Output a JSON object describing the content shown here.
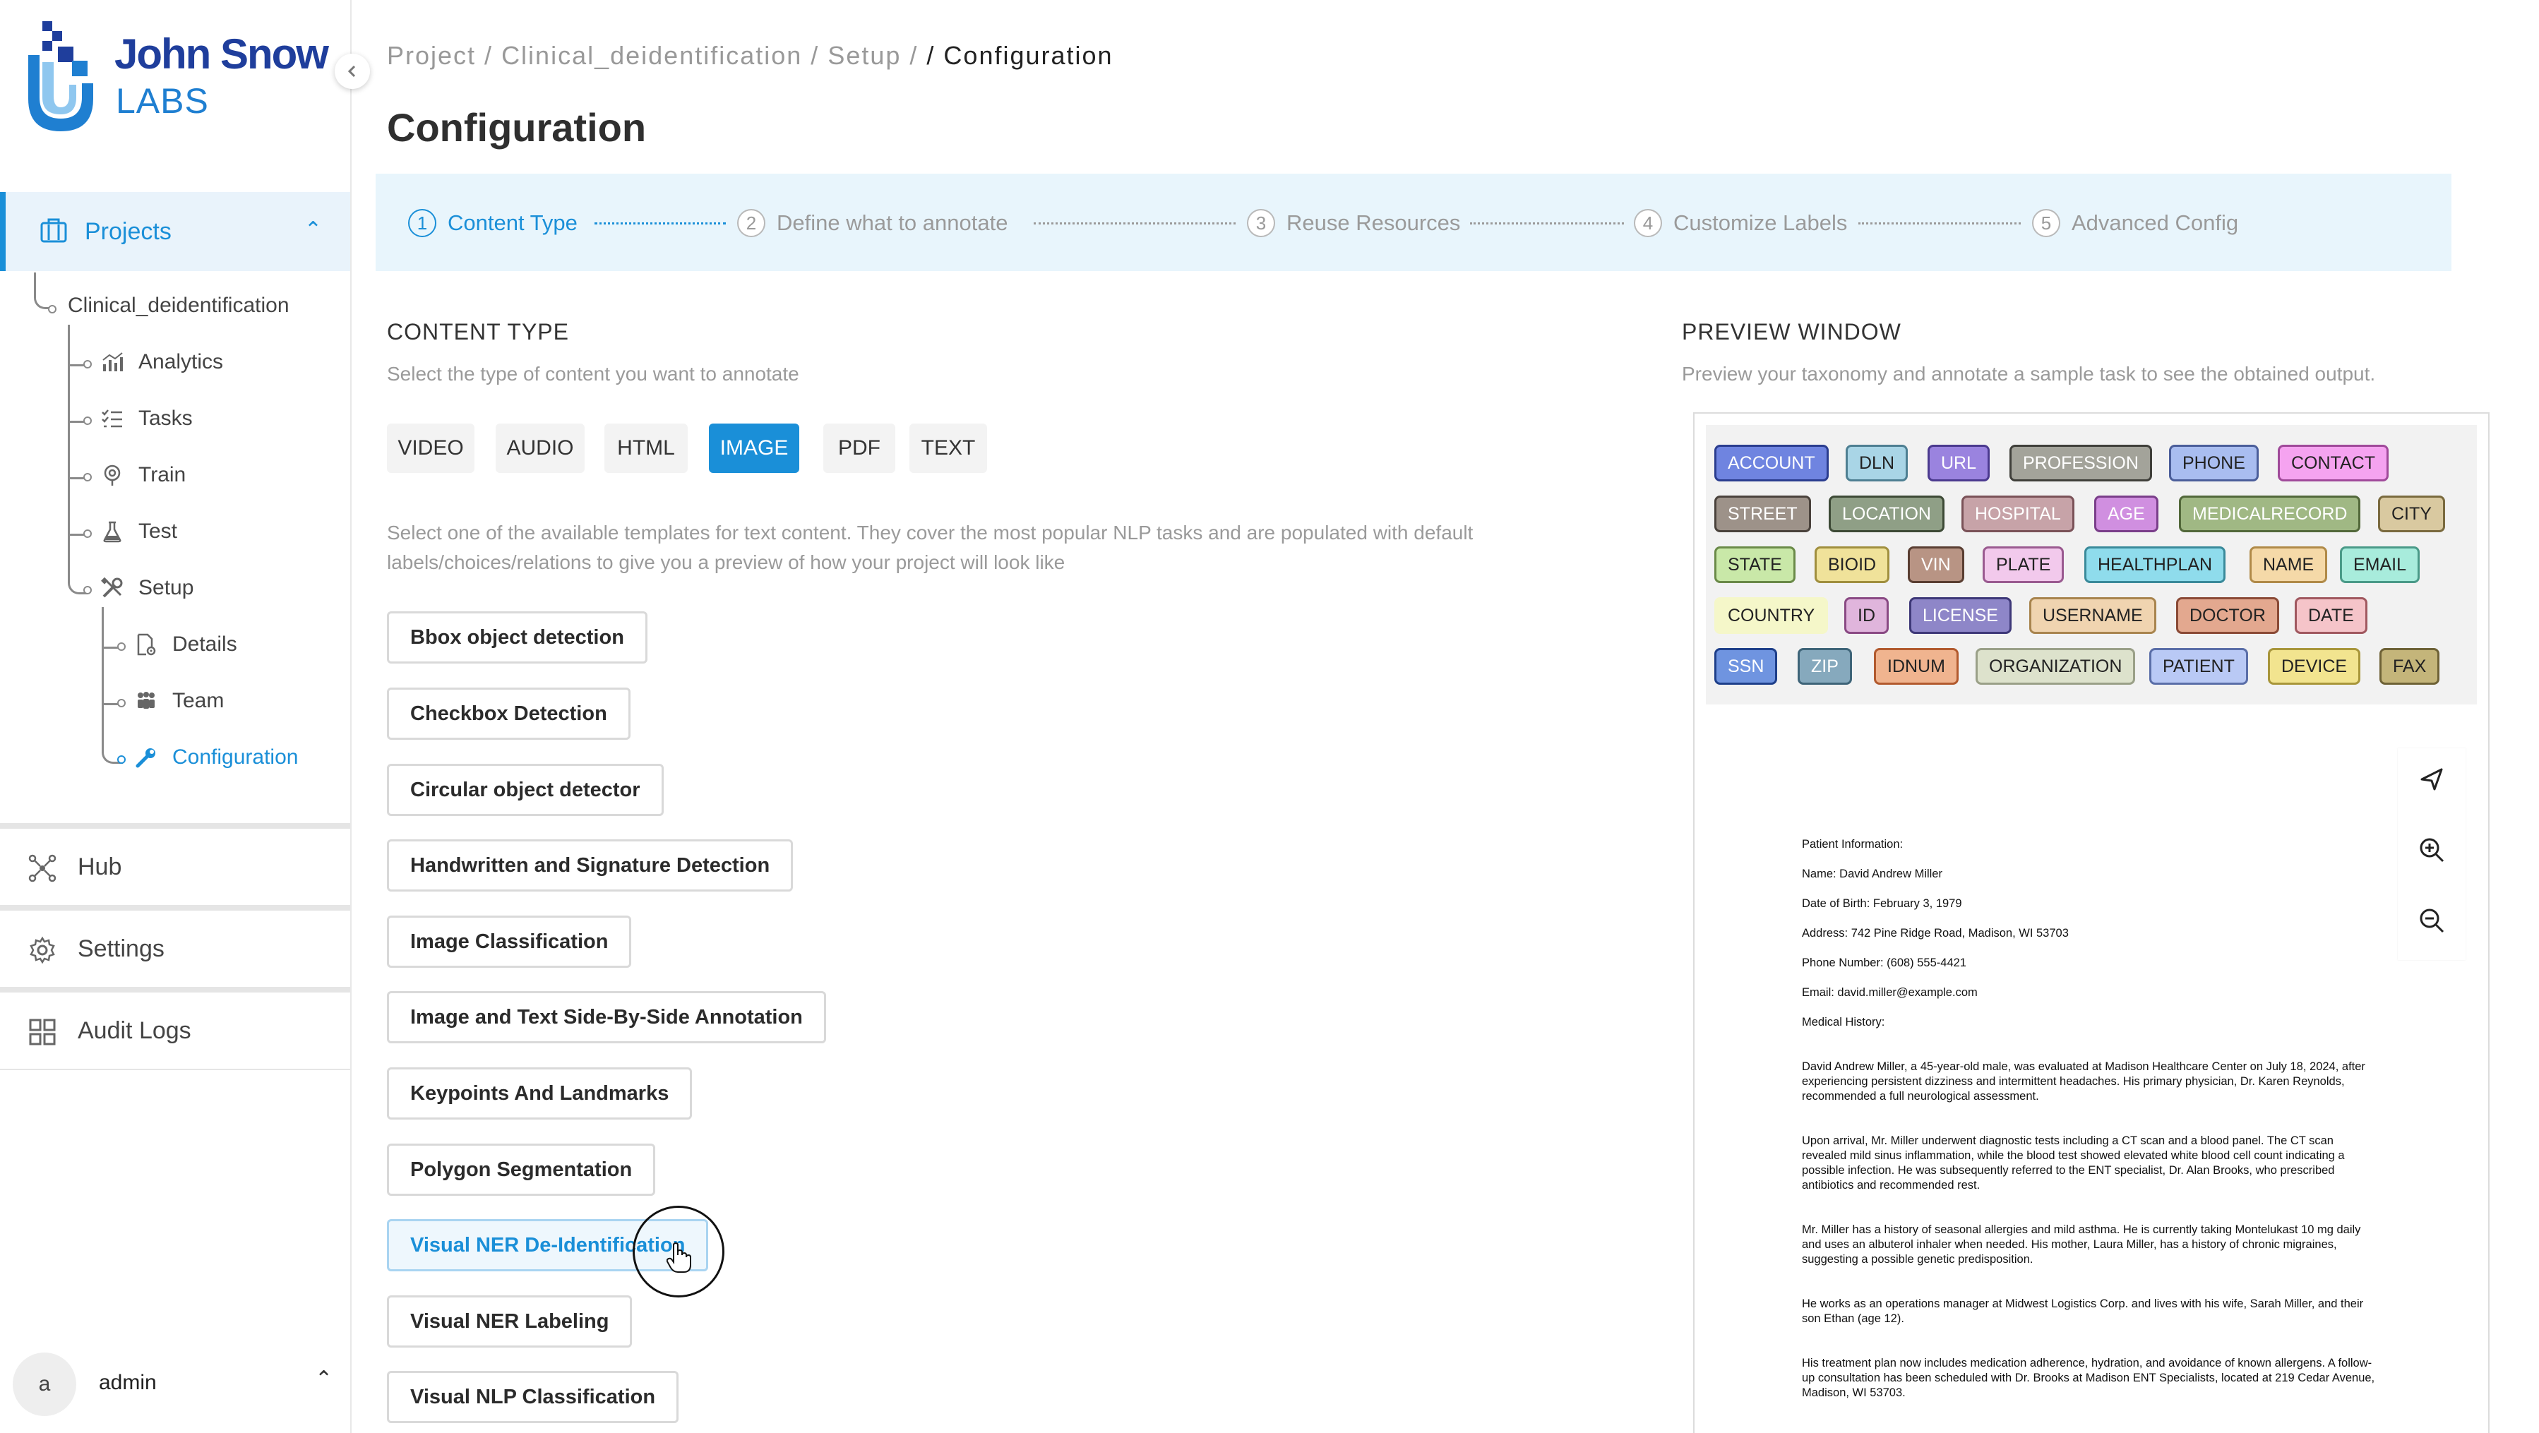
{
  "logo": {
    "line1": "John Snow",
    "line2": "LABS"
  },
  "sidebar": {
    "projects_label": "Projects",
    "project_name": "Clinical_deidentification",
    "project_items": [
      {
        "label": "Analytics",
        "icon": "analytics-icon"
      },
      {
        "label": "Tasks",
        "icon": "tasks-icon"
      },
      {
        "label": "Train",
        "icon": "train-icon"
      },
      {
        "label": "Test",
        "icon": "test-icon"
      },
      {
        "label": "Setup",
        "icon": "setup-icon"
      }
    ],
    "setup_items": [
      {
        "label": "Details",
        "icon": "details-icon"
      },
      {
        "label": "Team",
        "icon": "team-icon"
      },
      {
        "label": "Configuration",
        "icon": "wrench-icon",
        "active": true
      }
    ],
    "hub_label": "Hub",
    "settings_label": "Settings",
    "audit_logs_label": "Audit Logs",
    "user": {
      "avatar_initial": "a",
      "name": "admin"
    }
  },
  "breadcrumb": {
    "items": [
      "Project /",
      "Clinical_deidentification /",
      "Setup /"
    ],
    "current": "/ Configuration"
  },
  "page_title": "Configuration",
  "stepper": [
    {
      "num": "1",
      "label": "Content Type",
      "active": true
    },
    {
      "num": "2",
      "label": "Define what to annotate"
    },
    {
      "num": "3",
      "label": "Reuse Resources"
    },
    {
      "num": "4",
      "label": "Customize Labels"
    },
    {
      "num": "5",
      "label": "Advanced Config"
    }
  ],
  "content_type": {
    "heading": "CONTENT TYPE",
    "subtitle": "Select the type of content you want to annotate",
    "types": [
      "VIDEO",
      "AUDIO",
      "HTML",
      "IMAGE",
      "PDF",
      "TEXT"
    ],
    "selected": "IMAGE",
    "template_desc": "Select one of the available templates for text content. They cover the most popular NLP tasks and are populated with default labels/choices/relations to give you a preview of how your project will look like",
    "templates": [
      "Bbox object detection",
      "Checkbox Detection",
      "Circular object detector",
      "Handwritten and Signature Detection",
      "Image Classification",
      "Image and Text Side-By-Side Annotation",
      "Keypoints And Landmarks",
      "Polygon Segmentation",
      "Visual NER De-Identification",
      "Visual NER Labeling",
      "Visual NLP Classification"
    ],
    "selected_template": "Visual NER De-Identification"
  },
  "preview": {
    "heading": "PREVIEW WINDOW",
    "subtitle": "Preview your taxonomy and annotate a sample task to see the obtained output.",
    "labels": [
      {
        "text": "ACCOUNT",
        "bg": "#6f84e0",
        "border": "#2b3d8f",
        "color": "#ffffff"
      },
      {
        "text": "DLN",
        "bg": "#a9d5e6",
        "border": "#4e7f92",
        "color": "#222222"
      },
      {
        "text": "URL",
        "bg": "#9a83df",
        "border": "#4b3a8f",
        "color": "#ffffff"
      },
      {
        "text": "PROFESSION",
        "bg": "#a3a39a",
        "border": "#3f3f3a",
        "color": "#ffffff"
      },
      {
        "text": "PHONE",
        "bg": "#a9bdf0",
        "border": "#4b5e9a",
        "color": "#222222"
      },
      {
        "text": "CONTACT",
        "bg": "#f5a3f0",
        "border": "#a04a9a",
        "color": "#222222"
      },
      {
        "text": "STREET",
        "bg": "#9d9289",
        "border": "#4a423c",
        "color": "#ffffff"
      },
      {
        "text": "LOCATION",
        "bg": "#8f9f86",
        "border": "#3d4a36",
        "color": "#ffffff"
      },
      {
        "text": "HOSPITAL",
        "bg": "#c7a3a8",
        "border": "#7a5258",
        "color": "#ffffff"
      },
      {
        "text": "AGE",
        "bg": "#d08fe0",
        "border": "#7a3e8a",
        "color": "#ffffff"
      },
      {
        "text": "MEDICALRECORD",
        "bg": "#a0b884",
        "border": "#52683a",
        "color": "#ffffff"
      },
      {
        "text": "CITY",
        "bg": "#d9c9a0",
        "border": "#7a6a3e",
        "color": "#222222"
      },
      {
        "text": "STATE",
        "bg": "#c9e8a8",
        "border": "#6a8a48",
        "color": "#222222"
      },
      {
        "text": "BIOID",
        "bg": "#f0e29a",
        "border": "#a08f3e",
        "color": "#222222"
      },
      {
        "text": "VIN",
        "bg": "#b89484",
        "border": "#5a3e32",
        "color": "#ffffff"
      },
      {
        "text": "PLATE",
        "bg": "#f2c9ec",
        "border": "#9a5a90",
        "color": "#222222"
      },
      {
        "text": "HEALTHPLAN",
        "bg": "#8fdcec",
        "border": "#3a8a9a",
        "color": "#222222"
      },
      {
        "text": "NAME",
        "bg": "#f5d9a8",
        "border": "#b08a48",
        "color": "#222222"
      },
      {
        "text": "EMAIL",
        "bg": "#a8ecdc",
        "border": "#4a9a88",
        "color": "#222222"
      },
      {
        "text": "COUNTRY",
        "bg": "#f5f7c9",
        "border": "#f5f7c9",
        "color": "#222222"
      },
      {
        "text": "ID",
        "bg": "#e0b5dc",
        "border": "#8a4a84",
        "color": "#222222"
      },
      {
        "text": "LICENSE",
        "bg": "#8e86c8",
        "border": "#3e3878",
        "color": "#ffffff"
      },
      {
        "text": "USERNAME",
        "bg": "#f0d4b0",
        "border": "#a8844e",
        "color": "#222222"
      },
      {
        "text": "DOCTOR",
        "bg": "#e3a88f",
        "border": "#8a4a36",
        "color": "#222222"
      },
      {
        "text": "DATE",
        "bg": "#f5c4c9",
        "border": "#a0585f",
        "color": "#222222"
      },
      {
        "text": "SSN",
        "bg": "#6f94e0",
        "border": "#1e3f8a",
        "color": "#ffffff"
      },
      {
        "text": "ZIP",
        "bg": "#86a9bd",
        "border": "#3e6478",
        "color": "#ffffff"
      },
      {
        "text": "IDNUM",
        "bg": "#f0b48f",
        "border": "#b25a2e",
        "color": "#222222"
      },
      {
        "text": "ORGANIZATION",
        "bg": "#dde2cc",
        "border": "#9aa088",
        "color": "#222222"
      },
      {
        "text": "PATIENT",
        "bg": "#b9c9f5",
        "border": "#5a6ea8",
        "color": "#222222"
      },
      {
        "text": "DEVICE",
        "bg": "#f2e48f",
        "border": "#a8963a",
        "color": "#222222"
      },
      {
        "text": "FAX",
        "bg": "#c4b57a",
        "border": "#6e6236",
        "color": "#222222"
      }
    ],
    "tools": [
      "pointer-icon",
      "zoom-in-icon",
      "zoom-out-icon"
    ],
    "document": [
      "Patient Information:",
      "Name: David Andrew Miller",
      "Date of Birth: February 3, 1979",
      "Address: 742 Pine Ridge Road, Madison, WI 53703",
      "Phone Number: (608) 555-4421",
      "Email: david.miller@example.com",
      "Medical History:",
      "David Andrew Miller, a 45-year-old male, was evaluated at Madison Healthcare Center on July 18, 2024, after experiencing persistent dizziness and intermittent headaches. His primary physician, Dr. Karen Reynolds, recommended a full neurological assessment.",
      "Upon arrival, Mr. Miller underwent diagnostic tests including a CT scan and a blood panel. The CT scan revealed mild sinus inflammation, while the blood test showed elevated white blood cell count indicating a possible infection. He was subsequently referred to the ENT specialist, Dr. Alan Brooks, who prescribed antibiotics and recommended rest.",
      "Mr. Miller has a history of seasonal allergies and mild asthma. He is currently taking Montelukast 10 mg daily and uses an albuterol inhaler when needed. His mother, Laura Miller, has a history of chronic migraines, suggesting a possible genetic predisposition.",
      "He works as an operations manager at Midwest Logistics Corp. and lives with his wife, Sarah Miller, and their son Ethan (age 12).",
      "His treatment plan now includes medication adherence, hydration, and avoidance of known allergens. A follow-up consultation has been scheduled with Dr. Brooks at Madison ENT Specialists, located at 219 Cedar Avenue, Madison, WI 53703."
    ]
  },
  "colors": {
    "accent": "#1a8fd8",
    "stepper_bg": "#e8f5fc",
    "brand_dark": "#1f3e9c"
  }
}
